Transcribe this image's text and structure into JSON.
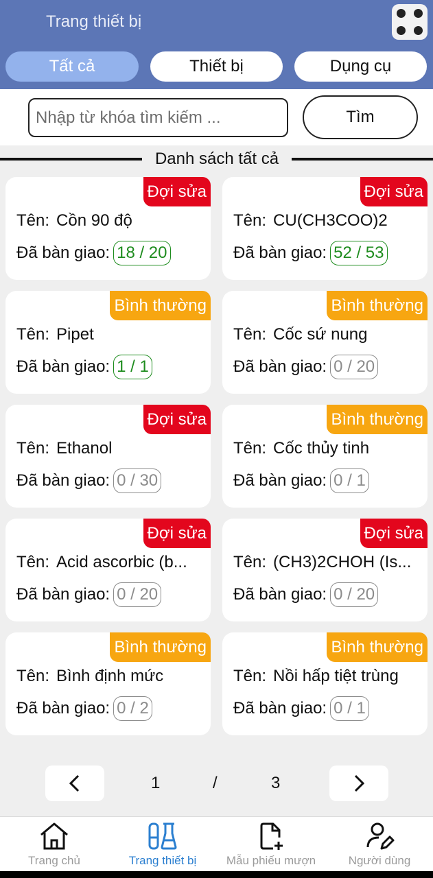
{
  "header": {
    "title": "Trang thiết bị",
    "menu_icon": "grid-dots-icon"
  },
  "tabs": [
    {
      "label": "Tất cả",
      "active": true
    },
    {
      "label": "Thiết bị",
      "active": false
    },
    {
      "label": "Dụng cụ",
      "active": false
    }
  ],
  "search": {
    "placeholder": "Nhập từ khóa tìm kiếm ...",
    "value": "",
    "button_label": "Tìm"
  },
  "section": {
    "title": "Danh sách tất cả"
  },
  "labels": {
    "name": "Tên:",
    "handover": "Đã bàn giao:"
  },
  "status_colors": {
    "Đợi sửa": "#e3061d",
    "Bình thường": "#f7a611"
  },
  "items": [
    {
      "status": "Đợi sửa",
      "name": "Cồn 90 độ",
      "handover": "18 / 20",
      "handover_color": "green"
    },
    {
      "status": "Đợi sửa",
      "name": "CU(CH3COO)2",
      "handover": "52 / 53",
      "handover_color": "green"
    },
    {
      "status": "Bình thường",
      "name": "Pipet",
      "handover": "1 / 1",
      "handover_color": "green"
    },
    {
      "status": "Bình thường",
      "name": "Cốc sứ nung",
      "handover": "0 / 20",
      "handover_color": "gray"
    },
    {
      "status": "Đợi sửa",
      "name": "Ethanol",
      "handover": "0 / 30",
      "handover_color": "gray"
    },
    {
      "status": "Bình thường",
      "name": "Cốc thủy tinh",
      "handover": "0 / 1",
      "handover_color": "gray"
    },
    {
      "status": "Đợi sửa",
      "name": "Acid ascorbic (b...",
      "handover": "0 / 20",
      "handover_color": "gray"
    },
    {
      "status": "Đợi sửa",
      "name": "(CH3)2CHOH (Is...",
      "handover": "0 / 20",
      "handover_color": "gray"
    },
    {
      "status": "Bình thường",
      "name": "Bình định mức",
      "handover": "0 / 2",
      "handover_color": "gray"
    },
    {
      "status": "Bình thường",
      "name": "Nồi hấp tiệt trùng",
      "handover": "0 / 1",
      "handover_color": "gray"
    }
  ],
  "pagination": {
    "current": "1",
    "separator": "/",
    "total": "3",
    "prev_icon": "chevron-left-icon",
    "next_icon": "chevron-right-icon"
  },
  "bottom_nav": [
    {
      "label": "Trang chủ",
      "icon": "home-icon",
      "active": false
    },
    {
      "label": "Trang thiết bị",
      "icon": "lab-flask-icon",
      "active": true
    },
    {
      "label": "Mẫu phiếu mượn",
      "icon": "file-add-icon",
      "active": false
    },
    {
      "label": "Người dùng",
      "icon": "user-edit-icon",
      "active": false
    }
  ]
}
